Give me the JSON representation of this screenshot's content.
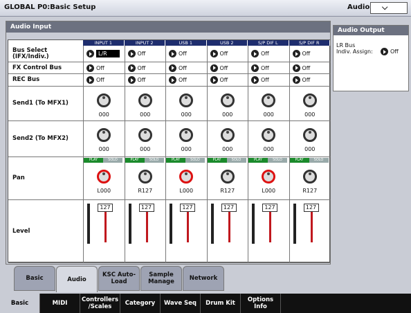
{
  "title": "GLOBAL P0:Basic Setup",
  "group_label": "Audio",
  "audio_input": {
    "header": "Audio Input",
    "columns": [
      "INPUT 1",
      "INPUT 2",
      "USB 1",
      "USB 2",
      "S/P DIF L",
      "S/P DIF R"
    ],
    "rows": {
      "bus_select": {
        "label_line1": "Bus Select",
        "label_line2": "(IFX/Indiv.)",
        "values": [
          "L/R",
          "Off",
          "Off",
          "Off",
          "Off",
          "Off"
        ]
      },
      "fx_control": {
        "label": "FX Control Bus",
        "values": [
          "Off",
          "Off",
          "Off",
          "Off",
          "Off",
          "Off"
        ]
      },
      "rec_bus": {
        "label": "REC Bus",
        "values": [
          "Off",
          "Off",
          "Off",
          "Off",
          "Off",
          "Off"
        ]
      },
      "send1": {
        "label": "Send1 (To MFX1)",
        "values": [
          "000",
          "000",
          "000",
          "000",
          "000",
          "000"
        ]
      },
      "send2": {
        "label": "Send2 (To MFX2)",
        "values": [
          "000",
          "000",
          "000",
          "000",
          "000",
          "000"
        ]
      },
      "pan": {
        "label": "Pan",
        "play": "PLAY",
        "solo": "SOLO",
        "values": [
          "L000",
          "R127",
          "L000",
          "R127",
          "L000",
          "R127"
        ]
      },
      "level": {
        "label": "Level",
        "values": [
          "127",
          "127",
          "127",
          "127",
          "127",
          "127"
        ]
      }
    }
  },
  "audio_output": {
    "header": "Audio Output",
    "label_line1": "LR Bus",
    "label_line2": "Indiv. Assign:",
    "value": "Off"
  },
  "sub_tabs": [
    "Basic",
    "Audio",
    "KSC Auto-Load",
    "Sample Manage",
    "Network"
  ],
  "main_tabs": [
    "Basic",
    "MIDI",
    "Controllers /Scales",
    "Category",
    "Wave Seq",
    "Drum Kit",
    "Options Info"
  ],
  "colors": {
    "accent": "#1e2d6e",
    "play": "#1a8a2b",
    "pan_red": "#d11111",
    "fader": "#c0181e"
  }
}
